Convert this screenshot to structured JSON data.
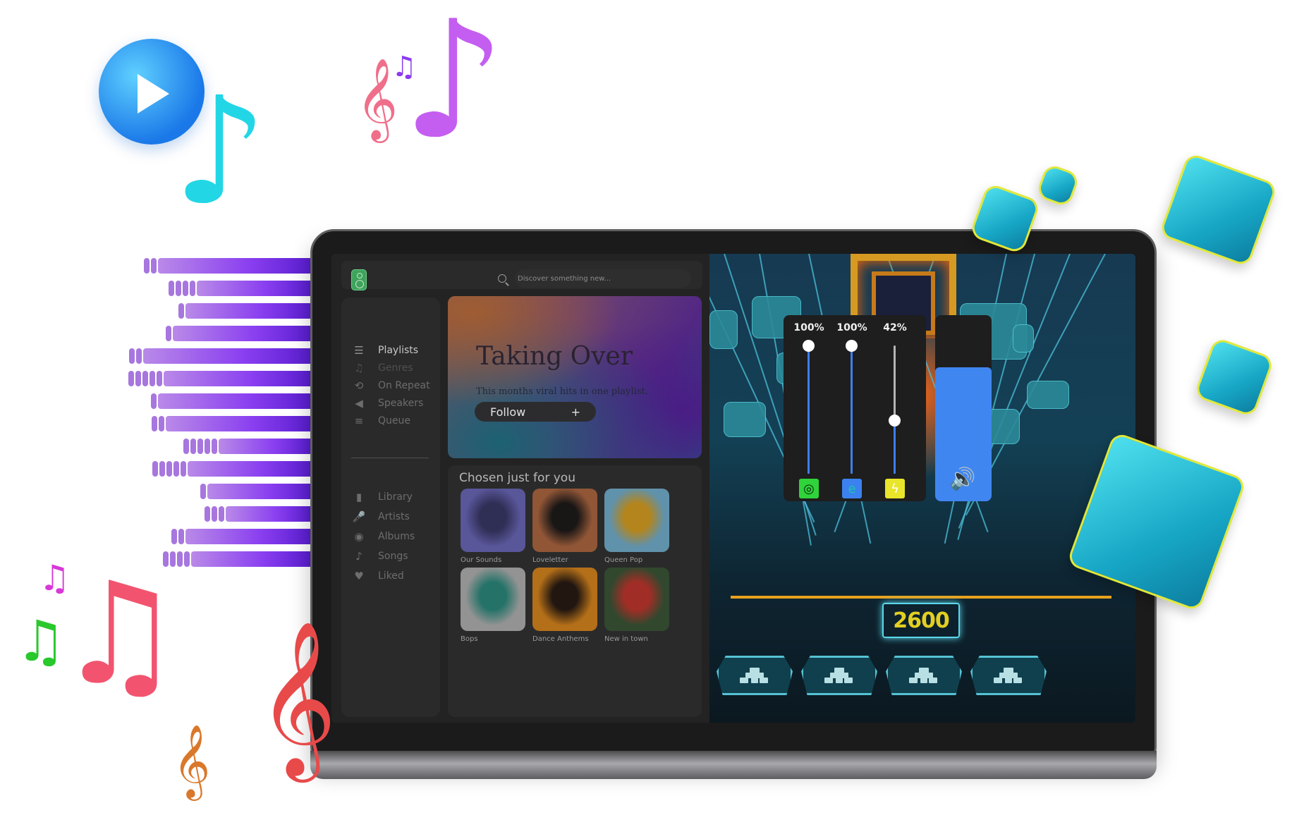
{
  "app": {
    "search": {
      "placeholder": "Discover something new..."
    },
    "sidebar": {
      "primary": [
        {
          "label": "Playlists",
          "icon": "playlist-icon",
          "glyph": "☰",
          "state": "active"
        },
        {
          "label": "Genres",
          "icon": "music-notes-icon",
          "glyph": "♫",
          "state": "dim"
        },
        {
          "label": "On Repeat",
          "icon": "repeat-icon",
          "glyph": "⟲",
          "state": "muted"
        },
        {
          "label": "Speakers",
          "icon": "speaker-icon",
          "glyph": "◀",
          "state": "muted"
        },
        {
          "label": "Queue",
          "icon": "queue-icon",
          "glyph": "≡",
          "state": "muted"
        }
      ],
      "secondary": [
        {
          "label": "Library",
          "icon": "bookmark-icon",
          "glyph": "▮"
        },
        {
          "label": "Artists",
          "icon": "microphone-icon",
          "glyph": "🎤"
        },
        {
          "label": "Albums",
          "icon": "disc-icon",
          "glyph": "◉"
        },
        {
          "label": "Songs",
          "icon": "music-note-icon",
          "glyph": "♪"
        },
        {
          "label": "Liked",
          "icon": "heart-icon",
          "glyph": "♥"
        }
      ]
    },
    "hero": {
      "title": "Taking Over",
      "subtitle": "This months viral hits in one playlist.",
      "follow_label": "Follow",
      "follow_icon": "+"
    },
    "chosen": {
      "title": "Chosen just for you",
      "cards": [
        {
          "label": "Our Sounds",
          "bg": "#6f6bbf",
          "accent": "#3b3a6a"
        },
        {
          "label": "Loveletter",
          "bg": "#b46b44",
          "accent": "#1f1b1b"
        },
        {
          "label": "Queen Pop",
          "bg": "#78b6d6",
          "accent": "#e1a624"
        },
        {
          "label": "Bops",
          "bg": "#b8b8b8",
          "accent": "#2d8f82"
        },
        {
          "label": "Dance Anthems",
          "bg": "#e18b1f",
          "accent": "#2a1c14"
        },
        {
          "label": "New in town",
          "bg": "#3d5a3a",
          "accent": "#c9392f"
        }
      ]
    }
  },
  "game": {
    "score": "2600",
    "volume_mixer": {
      "channels": [
        {
          "app": "green-app-icon",
          "glyph": "◎",
          "color": "#2fd33a",
          "fg": "#0b2a0e",
          "percent_label": "100%",
          "level": 1.0
        },
        {
          "app": "edge-browser-icon",
          "glyph": "e",
          "color": "#3b82f0",
          "fg": "#1bc4a8",
          "percent_label": "100%",
          "level": 1.0
        },
        {
          "app": "bolt-app-icon",
          "glyph": "ϟ",
          "color": "#e8e52a",
          "fg": "#ffffff",
          "percent_label": "42%",
          "level": 0.42
        }
      ],
      "master": {
        "icon": "speaker-volume-icon",
        "glyph": "🔊",
        "level": 0.72,
        "color": "#3f86f0"
      }
    },
    "pads_count": 4
  },
  "decor": {
    "eq_rows": [
      {
        "segments": 2,
        "length": 0.83
      },
      {
        "segments": 4,
        "length": 0.62
      },
      {
        "segments": 1,
        "length": 0.68
      },
      {
        "segments": 1,
        "length": 0.75
      },
      {
        "segments": 2,
        "length": 0.91
      },
      {
        "segments": 5,
        "length": 0.8
      },
      {
        "segments": 1,
        "length": 0.83
      },
      {
        "segments": 2,
        "length": 0.79
      },
      {
        "segments": 5,
        "length": 0.5
      },
      {
        "segments": 5,
        "length": 0.67
      },
      {
        "segments": 1,
        "length": 0.56
      },
      {
        "segments": 3,
        "length": 0.46
      },
      {
        "segments": 2,
        "length": 0.68
      },
      {
        "segments": 4,
        "length": 0.65
      }
    ],
    "eq_color": "#8a3ff0"
  }
}
